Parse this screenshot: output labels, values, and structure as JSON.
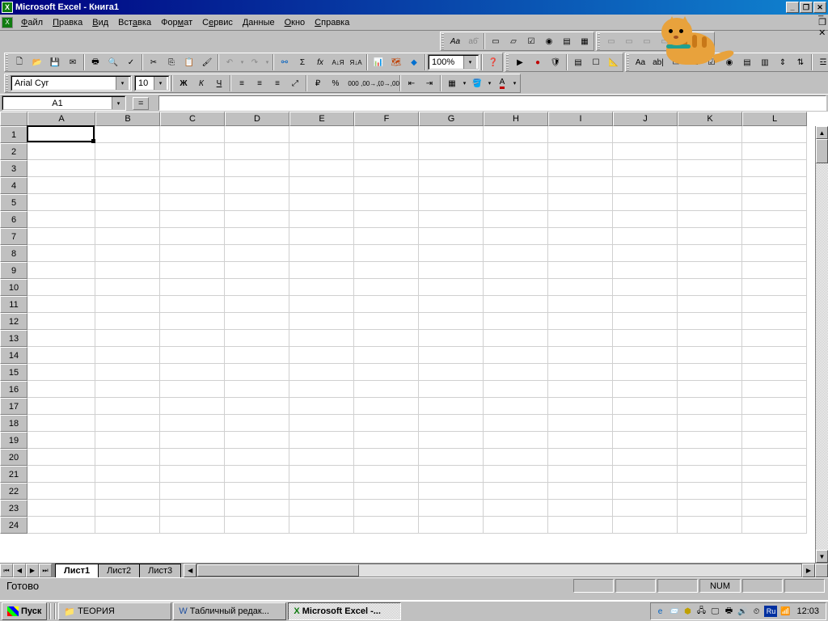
{
  "titlebar": {
    "app": "Microsoft Excel",
    "doc": "Книга1",
    "full": "Microsoft Excel - Книга1"
  },
  "menu": {
    "file": "Файл",
    "edit": "Правка",
    "view": "Вид",
    "insert": "Вставка",
    "format": "Формат",
    "tools": "Сервис",
    "data": "Данные",
    "window": "Окно",
    "help": "Справка"
  },
  "formatting": {
    "font": "Arial Cyr",
    "size": "10",
    "bold": "Ж",
    "italic": "К",
    "underline": "Ч",
    "percent": "%",
    "thousands": "000"
  },
  "standard": {
    "zoom": "100%",
    "autosum_label": "Σ",
    "fx_label": "fx",
    "sort_asc": "А↓Я",
    "sort_desc": "Я↓А"
  },
  "formula": {
    "cell_ref": "A1",
    "eq": "="
  },
  "columns": [
    "A",
    "B",
    "C",
    "D",
    "E",
    "F",
    "G",
    "H",
    "I",
    "J",
    "K",
    "L"
  ],
  "rows": [
    "1",
    "2",
    "3",
    "4",
    "5",
    "6",
    "7",
    "8",
    "9",
    "10",
    "11",
    "12",
    "13",
    "14",
    "15",
    "16",
    "17",
    "18",
    "19",
    "20",
    "21",
    "22",
    "23",
    "24"
  ],
  "sheet_tabs": {
    "t1": "Лист1",
    "t2": "Лист2",
    "t3": "Лист3"
  },
  "status": {
    "ready": "Готово",
    "num": "NUM"
  },
  "taskbar": {
    "start": "Пуск",
    "folder": "ТЕОРИЯ",
    "word": "Табличный редак...",
    "excel": "Microsoft Excel -...",
    "lang": "Ru",
    "clock": "12:03"
  }
}
